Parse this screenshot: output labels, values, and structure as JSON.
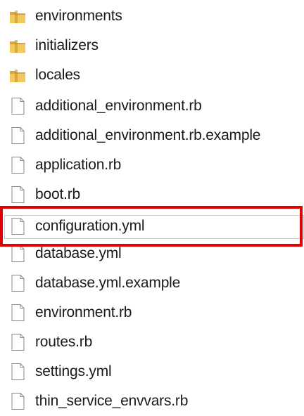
{
  "colors": {
    "highlight": "#e00000",
    "folder": "#e8b84a",
    "file_outline": "#8a8a8a"
  },
  "items": [
    {
      "label": "environments",
      "icon": "folder-icon"
    },
    {
      "label": "initializers",
      "icon": "folder-icon"
    },
    {
      "label": "locales",
      "icon": "folder-icon"
    },
    {
      "label": "additional_environment.rb",
      "icon": "file-icon"
    },
    {
      "label": "additional_environment.rb.example",
      "icon": "file-icon"
    },
    {
      "label": "application.rb",
      "icon": "file-icon"
    },
    {
      "label": "boot.rb",
      "icon": "file-icon"
    },
    {
      "label": "configuration.yml",
      "icon": "file-icon",
      "highlighted": true
    },
    {
      "label": "database.yml",
      "icon": "file-icon"
    },
    {
      "label": "database.yml.example",
      "icon": "file-icon"
    },
    {
      "label": "environment.rb",
      "icon": "file-icon"
    },
    {
      "label": "routes.rb",
      "icon": "file-icon"
    },
    {
      "label": "settings.yml",
      "icon": "file-icon"
    },
    {
      "label": "thin_service_envvars.rb",
      "icon": "file-icon"
    }
  ]
}
